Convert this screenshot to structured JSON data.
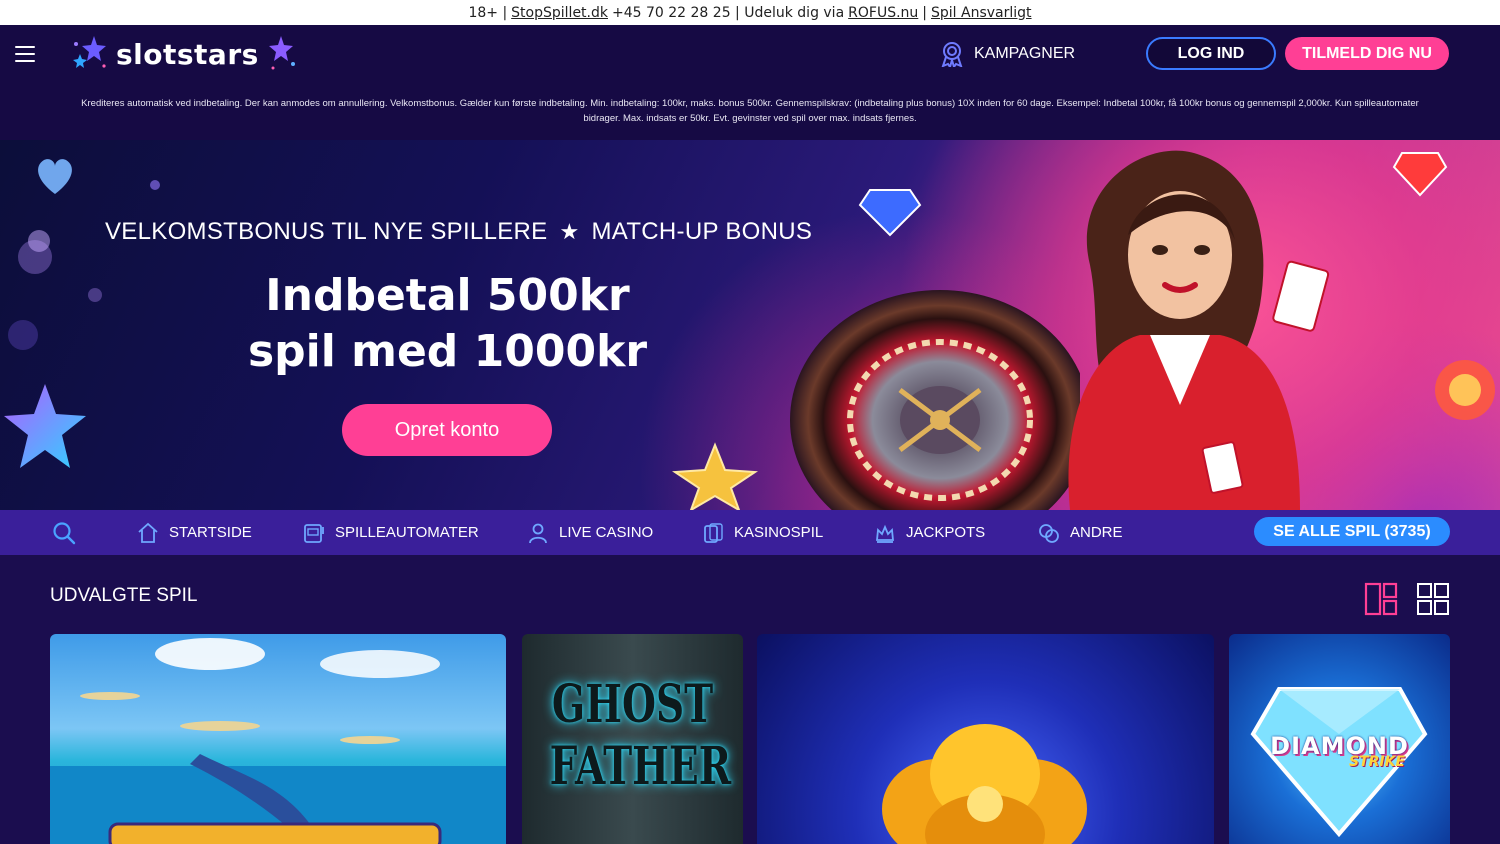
{
  "topbar": {
    "prefix": "18+ |",
    "stopspillet": "StopSpillet.dk",
    "phone": "+45 70 22 28 25 | Udeluk dig via",
    "rofus": "ROFUS.nu",
    "separator": "|",
    "responsible": "Spil Ansvarligt"
  },
  "header": {
    "logo": "slotstars",
    "campaigns": "KAMPAGNER",
    "login": "LOG IND",
    "signup": "TILMELD DIG NU"
  },
  "terms": "Krediteres automatisk ved indbetaling. Der kan anmodes om annullering. Velkomstbonus. Gælder kun første indbetaling. Min. indbetaling: 100kr, maks. bonus 500kr. Gennemspilskrav: (indbetaling plus bonus) 10X inden for 60 dage. Eksempel: Indbetal 100kr, få 100kr bonus og gennemspil 2,000kr. Kun spilleautomater bidrager. Max. indsats er 50kr. Evt. gevinster ved spil over max. indsats fjernes.",
  "hero": {
    "subtitle_left": "VELKOMSTBONUS TIL NYE SPILLERE",
    "subtitle_right": "MATCH-UP BONUS",
    "line1": "Indbetal 500kr",
    "line2": "spil med 1000kr",
    "cta": "Opret konto"
  },
  "categories": [
    {
      "label": "STARTSIDE",
      "icon": "home-icon"
    },
    {
      "label": "SPILLEAUTOMATER",
      "icon": "slot-machine-icon"
    },
    {
      "label": "LIVE CASINO",
      "icon": "dealer-icon"
    },
    {
      "label": "KASINOSPIL",
      "icon": "cards-icon"
    },
    {
      "label": "JACKPOTS",
      "icon": "jackpot-icon"
    },
    {
      "label": "ANDRE",
      "icon": "chips-icon"
    }
  ],
  "all_games": "SE ALLE SPIL (3735)",
  "featured": {
    "title": "UDVALGTE SPIL",
    "games": [
      {
        "name": "fishing-slot"
      },
      {
        "name": "Ghost Father",
        "text1": "GHOST",
        "text2": "FATHER"
      },
      {
        "name": "golden-flower-slot"
      },
      {
        "name": "Diamond Strike",
        "text1": "DIAMOND",
        "text2": "STRIKE"
      }
    ]
  },
  "colors": {
    "accent_pink": "#ff3f95",
    "accent_blue": "#2b8cff",
    "header_bg": "#160a44",
    "nav_bg": "#3a1f9a",
    "page_bg": "#1b0d4f"
  }
}
